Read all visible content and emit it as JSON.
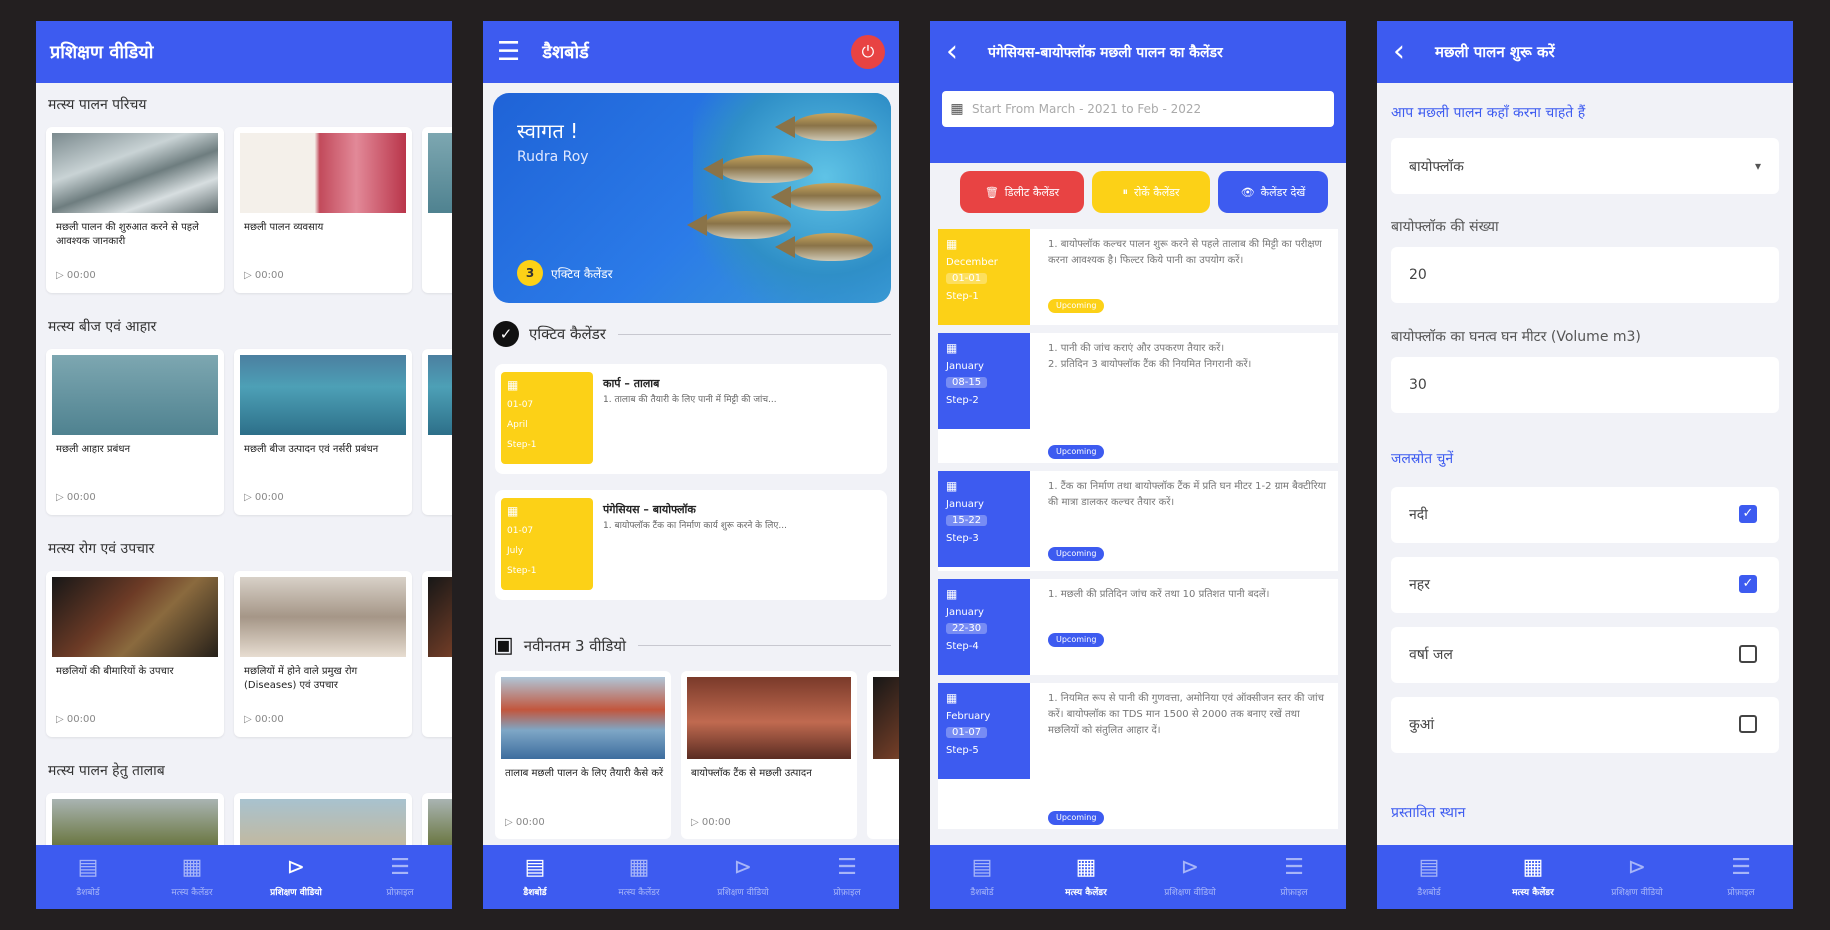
{
  "colors": {
    "primary": "#3d5bf0",
    "yellow": "#fcd117",
    "red": "#e84343",
    "background": "#231f20",
    "tag_yellow": "#fcd117",
    "tag_blue": "#3d5bf0"
  },
  "nav": {
    "icons": [
      "dashboard-icon",
      "calendar-icon",
      "play-video-icon",
      "sliders-icon"
    ],
    "labels": [
      "डैशबोर्ड",
      "मत्स्य कैलेंडर",
      "प्रशिक्षण वीडियो",
      "प्रोफ़ाइल"
    ]
  },
  "screen1": {
    "title": "प्रशिक्षण वीडियो",
    "sections": [
      {
        "title": "मत्स्य पालन परिचय",
        "videos": [
          {
            "title": "मछली पालन की शुरुआत करने से पहले आवश्यक जानकारी",
            "duration": "00:00"
          },
          {
            "title": "मछली पालन व्यवसाय",
            "duration": "00:00"
          }
        ]
      },
      {
        "title": "मत्स्य बीज एवं आहार",
        "videos": [
          {
            "title": "मछली आहार प्रबंधन",
            "duration": "00:00"
          },
          {
            "title": "मछली बीज उत्पादन एवं नर्सरी प्रबंधन",
            "duration": "00:00"
          }
        ]
      },
      {
        "title": "मत्स्य रोग एवं उपचार",
        "videos": [
          {
            "title": "मछलियों की बीमारियों के उपचार",
            "duration": "00:00"
          },
          {
            "title": "मछलियों में होने वाले प्रमुख रोग (Diseases) एवं उपचार",
            "duration": "00:00"
          }
        ]
      },
      {
        "title": "मत्स्य पालन हेतु तालाब",
        "videos": []
      }
    ]
  },
  "screen2": {
    "title": "डैशबोर्ड",
    "welcome": "स्वागत !",
    "user": "Rudra Roy",
    "active_count": "3",
    "active_label": "एक्टिव कैलेंडर",
    "active_section": "एक्टिव कैलेंडर",
    "active_cards": [
      {
        "date": "01-07",
        "month": "April",
        "step": "Step-1",
        "title": "कार्प – तालाब",
        "desc": "1. तालाब की तैयारी के लिए पानी में मिट्टी की जांच..."
      },
      {
        "date": "01-07",
        "month": "July",
        "step": "Step-1",
        "title": "पंगेसियस – बायोफ्लॉक",
        "desc": "1. बायोफ्लॉक टैंक का निर्माण कार्य शुरू करने के लिए..."
      }
    ],
    "videos_section": "नवीनतम 3 वीडियो",
    "latest_videos": [
      {
        "title": "तालाब मछली पालन के लिए तैयारी कैसे करें",
        "duration": "00:00"
      },
      {
        "title": "बायोफ्लॉक टैंक से मछली उत्पादन",
        "duration": "00:00"
      }
    ]
  },
  "screen3": {
    "title": "पंगेसियस-बायोफ्लॉक मछली पालन का कैलेंडर",
    "range": "Start From March - 2021 to Feb - 2022",
    "buttons": {
      "delete": "डिलीट कैलेंडर",
      "pause": "रोकें कैलेंडर",
      "view": "कैलेंडर देखें"
    },
    "steps": [
      {
        "month": "December",
        "date": "01-01",
        "step": "Step-1",
        "desc": "1. बायोफ्लॉक कल्चर पालन शुरू करने से पहले तालाब की मिट्टी का परीक्षण करना आवश्यक है। फिल्टर किये पानी का उपयोग करें।",
        "tag": "Upcoming"
      },
      {
        "month": "January",
        "date": "08-15",
        "step": "Step-2",
        "desc": "1. पानी की जांच कराएं और उपकरण तैयार करें।\n2. प्रतिदिन 3 बायोफ्लॉक टैंक की नियमित निगरानी करें।",
        "tag": "Upcoming"
      },
      {
        "month": "January",
        "date": "15-22",
        "step": "Step-3",
        "desc": "1. टैंक का निर्माण तथा बायोफ्लॉक टैंक में प्रति घन मीटर 1-2 ग्राम बैक्टीरिया की मात्रा डालकर कल्चर तैयार करें।",
        "tag": "Upcoming"
      },
      {
        "month": "January",
        "date": "22-30",
        "step": "Step-4",
        "desc": "1. मछली की प्रतिदिन जांच करें तथा 10 प्रतिशत पानी बदलें।",
        "tag": "Upcoming"
      },
      {
        "month": "February",
        "date": "01-07",
        "step": "Step-5",
        "desc": "1. नियमित रूप से पानी की गुणवत्ता, अमोनिया एवं ऑक्सीजन स्तर की जांच करें। बायोफ्लॉक का TDS मान 1500 से 2000 तक बनाए रखें तथा मछलियों को संतुलित आहार दें।",
        "tag": "Upcoming"
      }
    ]
  },
  "screen4": {
    "title": "मछली पालन शुरू करें",
    "q1": "आप मछली पालन कहाँ करना चाहते हैं",
    "q1_value": "बायोफ्लॉक",
    "q2": "बायोफ्लॉक की संख्या",
    "q2_value": "20",
    "q3": "बायोफ्लॉक का घनत्व घन मीटर (Volume m3)",
    "q3_value": "30",
    "water_label": "जलस्रोत चुनें",
    "water_options": [
      {
        "label": "नदी",
        "checked": true
      },
      {
        "label": "नहर",
        "checked": true
      },
      {
        "label": "वर्षा जल",
        "checked": false
      },
      {
        "label": "कुआं",
        "checked": false
      }
    ],
    "next_label": "प्रस्तावित स्थान"
  }
}
